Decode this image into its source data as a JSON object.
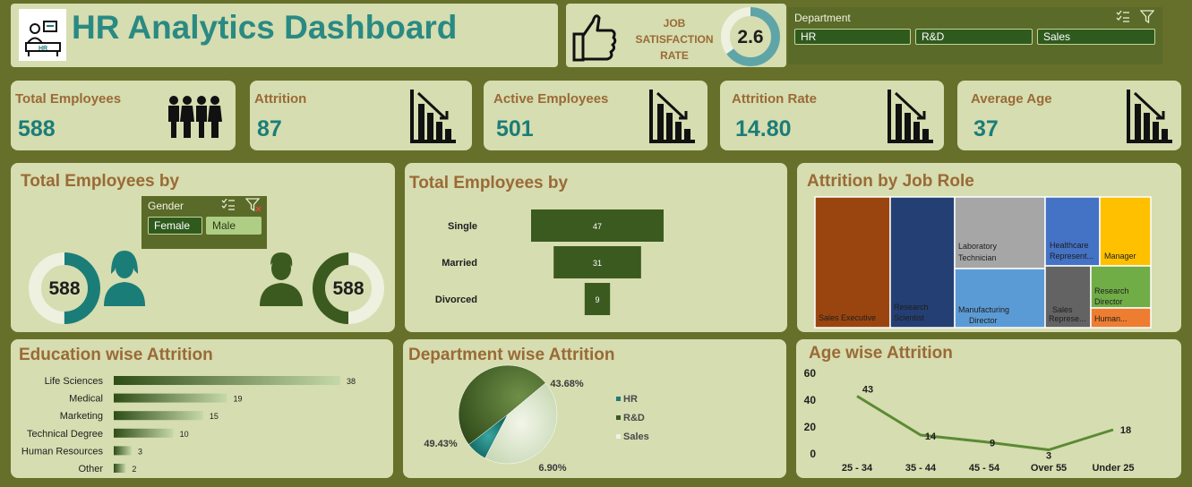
{
  "header": {
    "title": "HR Analytics Dashboard",
    "logo_text": "HR"
  },
  "job_satisfaction": {
    "label_lines": [
      "JOB",
      "SATISFACTION",
      "RATE"
    ],
    "value": "2.6",
    "fraction": 0.65
  },
  "department_slicer": {
    "header": "Department",
    "options": [
      "HR",
      "R&D",
      "Sales"
    ]
  },
  "kpis": [
    {
      "label": "Total Employees",
      "value": "588",
      "icon": "people-icon"
    },
    {
      "label": "Attrition",
      "value": "87",
      "icon": "chart-down-icon"
    },
    {
      "label": "Active Employees",
      "value": "501",
      "icon": "chart-down-icon"
    },
    {
      "label": "Attrition Rate",
      "value": "14.80",
      "icon": "chart-down-icon"
    },
    {
      "label": "Average Age",
      "value": "37",
      "icon": "chart-down-icon"
    }
  ],
  "gender_panel": {
    "title": "Total Employees by",
    "slicer": {
      "header": "Gender",
      "options": [
        "Female",
        "Male"
      ],
      "selected": "Male"
    },
    "female_value": "588",
    "male_value": "588",
    "colors": {
      "female": "#1b7d78",
      "male": "#3b5a1f"
    }
  },
  "marital_panel": {
    "title": "Total Employees by"
  },
  "jobrole_panel": {
    "title": "Attrition by Job Role"
  },
  "education_panel": {
    "title": "Education wise Attrition"
  },
  "department_panel": {
    "title": "Department wise Attrition"
  },
  "age_panel": {
    "title": "Age wise Attrition"
  },
  "chart_data": [
    {
      "type": "bar",
      "orientation": "horizontal",
      "categories": [
        "Single",
        "Married",
        "Divorced"
      ],
      "values": [
        47,
        31,
        9
      ],
      "style": "funnel",
      "color": "#3b5a1f"
    },
    {
      "type": "treemap",
      "items": [
        {
          "label": "Sales Executive",
          "color": "#9a4510"
        },
        {
          "label": "Research Scientist",
          "color": "#243f73"
        },
        {
          "label": "Laboratory Technician",
          "color": "#a6a6a6"
        },
        {
          "label": "Manufacturing Director",
          "color": "#5b9bd5"
        },
        {
          "label": "Healthcare Represent...",
          "color": "#4472c4"
        },
        {
          "label": "Manager",
          "color": "#ffc000"
        },
        {
          "label": "Sales Represe...",
          "color": "#636363"
        },
        {
          "label": "Research Director",
          "color": "#70ad47"
        },
        {
          "label": "Human...",
          "color": "#ed7d31"
        }
      ]
    },
    {
      "type": "bar",
      "orientation": "horizontal",
      "categories": [
        "Life Sciences",
        "Medical",
        "Marketing",
        "Technical Degree",
        "Human Resources",
        "Other"
      ],
      "values": [
        38,
        19,
        15,
        10,
        3,
        2
      ],
      "color": "#3b5a1f"
    },
    {
      "type": "pie",
      "labels": [
        "HR",
        "R&D",
        "Sales"
      ],
      "values": [
        6.9,
        49.43,
        43.68
      ],
      "value_labels": [
        "6.90%",
        "49.43%",
        "43.68%"
      ],
      "colors": [
        "#1b7d78",
        "#3b5a1f",
        "#dfe8cf"
      ]
    },
    {
      "type": "line",
      "categories": [
        "25 - 34",
        "35 - 44",
        "45 - 54",
        "Over 55",
        "Under 25"
      ],
      "values": [
        43,
        14,
        9,
        3,
        18
      ],
      "ylim": [
        0,
        60
      ],
      "yticks": [
        0,
        20,
        40,
        60
      ],
      "color": "#5b8a34"
    }
  ]
}
